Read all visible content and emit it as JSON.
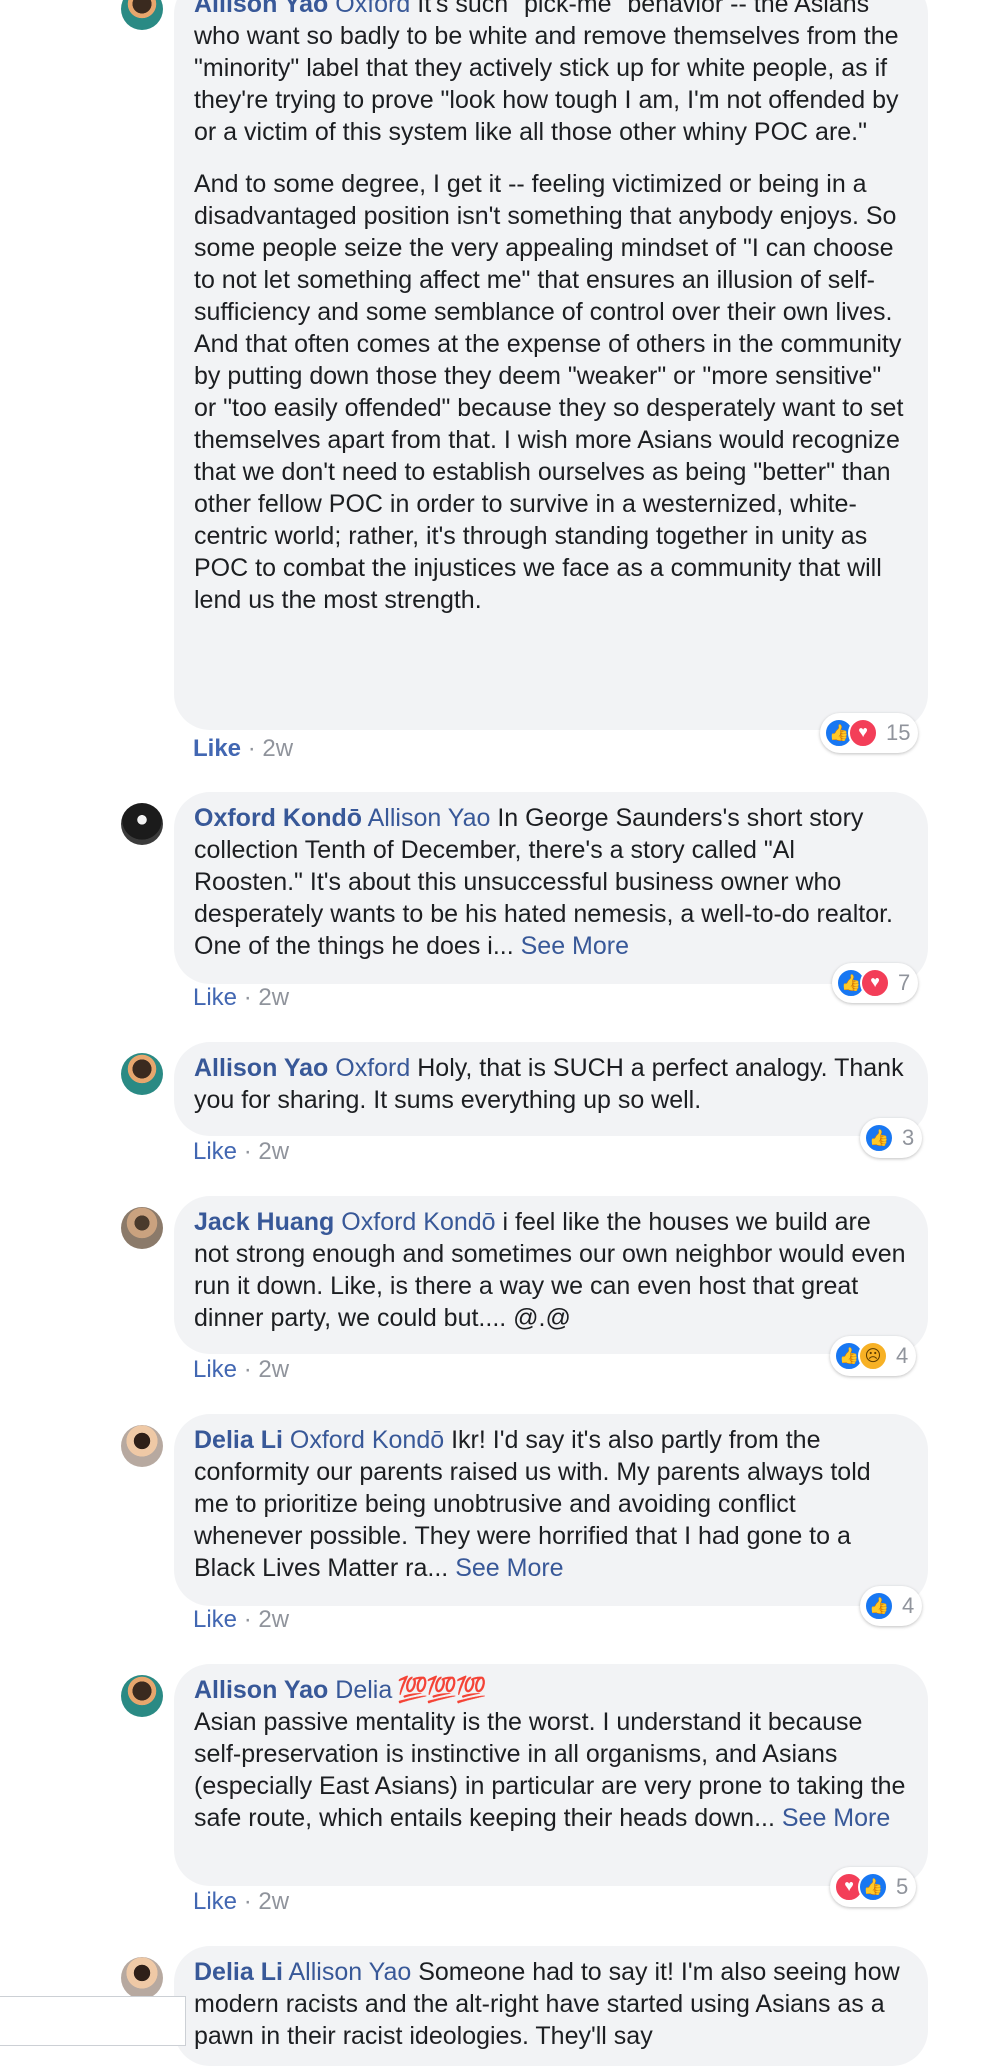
{
  "comments": [
    {
      "author": "Allison Yao",
      "mention": "Oxford",
      "paragraphs": [
        " It's such \"pick-me\" behavior -- the Asians who want so badly to be white and remove themselves from the \"minority\" label that they actively stick up for white people, as if they're trying to prove \"look how tough I am, I'm not offended by or a victim of this system like all those other whiny POC are.\"",
        "And to some degree, I get it -- feeling victimized or being in a disadvantaged position isn't something that anybody enjoys. So some people seize the very appealing mindset of \"I can choose to not let something affect me\" that ensures an illusion of self-sufficiency and some semblance of control over their own lives. And that often comes at the expense of others in the community by putting down those they deem \"weaker\" or \"more sensitive\" or \"too easily offended\" because they so desperately want to set themselves apart from that. I wish more Asians would recognize that we don't need to establish ourselves as being \"better\" than other fellow POC in order to survive in a westernized, white-centric world; rather, it's through standing together in unity as POC to combat the injustices we face as a community that will lend us the most strength."
      ],
      "like_label": "Like",
      "time": "2w",
      "reaction_count": "15",
      "reactions": [
        "like-icon",
        "love-icon"
      ]
    },
    {
      "author": "Oxford Kondō",
      "mention": "Allison Yao",
      "text": " In George Saunders's short story collection Tenth of December, there's a story called \"Al Roosten.\" It's about this unsuccessful business owner who desperately wants to be his hated nemesis, a well-to-do realtor. One of the things he does i... ",
      "see_more": "See More",
      "like_label": "Like",
      "time": "2w",
      "reaction_count": "7",
      "reactions": [
        "like-icon",
        "love-icon"
      ]
    },
    {
      "author": "Allison Yao",
      "mention": "Oxford",
      "text": " Holy, that is SUCH a perfect analogy. Thank you for sharing. It sums everything up so well.",
      "like_label": "Like",
      "time": "2w",
      "reaction_count": "3",
      "reactions": [
        "like-icon"
      ]
    },
    {
      "author": "Jack Huang",
      "mention": "Oxford Kondō",
      "text": " i feel like the houses we build are not strong enough and sometimes our own neighbor would even run it down. Like, is there a way we can even host that great dinner party, we could but.... @.@",
      "like_label": "Like",
      "time": "2w",
      "reaction_count": "4",
      "reactions": [
        "like-icon",
        "sad-icon"
      ]
    },
    {
      "author": "Delia Li",
      "mention": "Oxford Kondō",
      "text": " Ikr! I'd say it's also partly from the conformity our parents raised us with. My parents always told me to prioritize being unobtrusive and avoiding conflict whenever possible. They were horrified that I had gone to a Black Lives Matter ra... ",
      "see_more": "See More",
      "like_label": "Like",
      "time": "2w",
      "reaction_count": "4",
      "reactions": [
        "like-icon"
      ]
    },
    {
      "author": "Allison Yao",
      "mention": "Delia",
      "emoji": " 💯💯💯",
      "text": "Asian passive mentality is the worst. I understand it because self-preservation is instinctive in all organisms, and Asians (especially East Asians) in particular are very prone to taking the safe route, which entails keeping their heads down... ",
      "see_more": "See More",
      "like_label": "Like",
      "time": "2w",
      "reaction_count": "5",
      "reactions": [
        "love-icon",
        "like-icon"
      ]
    },
    {
      "author": "Delia Li",
      "mention": "Allison Yao",
      "text": " Someone had to say it! I'm also seeing how modern racists and the alt-right have started using Asians as a pawn in their racist ideologies. They'll say"
    }
  ],
  "separator": " · ",
  "colors": {
    "link": "#385898",
    "bubble": "#f2f3f5",
    "like_blue": "#1877f2",
    "love_red": "#f33e58"
  }
}
